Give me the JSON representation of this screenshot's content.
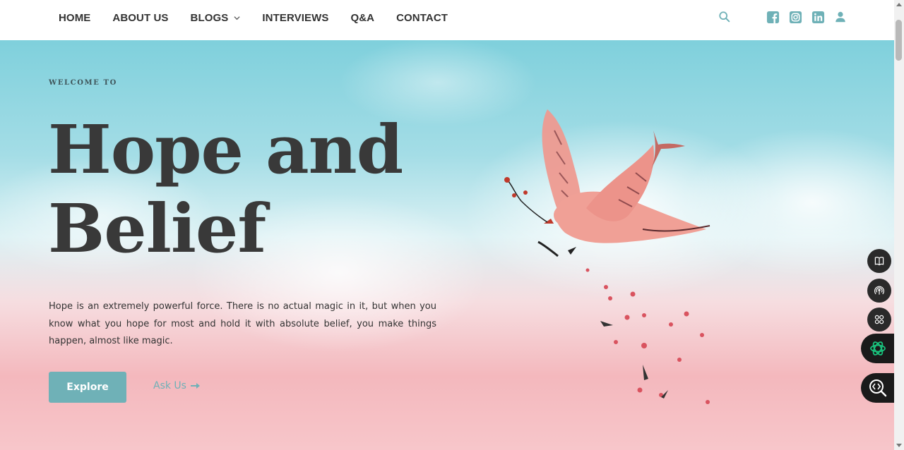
{
  "nav": {
    "items": [
      {
        "label": "HOME"
      },
      {
        "label": "ABOUT US"
      },
      {
        "label": "BLOGS"
      },
      {
        "label": "INTERVIEWS"
      },
      {
        "label": "Q&A"
      },
      {
        "label": "CONTACT"
      }
    ],
    "icons": [
      "search-icon",
      "facebook-icon",
      "instagram-icon",
      "linkedin-icon",
      "user-icon"
    ]
  },
  "hero": {
    "welcome": "WELCOME TO",
    "title_line1": "Hope and",
    "title_line2": "Belief",
    "description": "Hope is an extremely powerful force. There is no actual magic in it, but when you know what you hope for most and hold it with absolute belief, you make things happen, almost like magic.",
    "explore_label": "Explore",
    "ask_label": "Ask Us"
  },
  "floating": {
    "icons": [
      "book-icon",
      "podcast-icon",
      "grid-icon",
      "openai-icon",
      "code-search-icon"
    ]
  },
  "colors": {
    "accent": "#6fb1b7",
    "text_dark": "#393939",
    "nav_text": "#333333"
  }
}
